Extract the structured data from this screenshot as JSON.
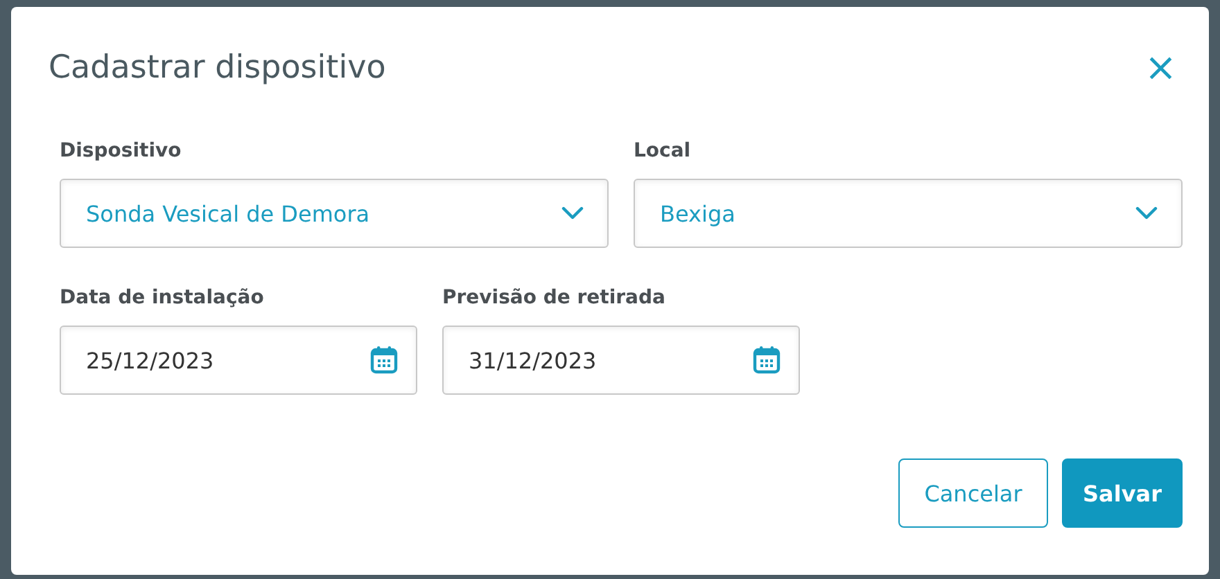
{
  "dialog": {
    "title": "Cadastrar dispositivo",
    "close": "×"
  },
  "selects": [
    {
      "label": "Dispositivo",
      "value": "Sonda Vesical de Demora"
    },
    {
      "label": "Local",
      "value": "Bexiga"
    }
  ],
  "dates": [
    {
      "label": "Data de instalação",
      "value": "25/12/2023"
    },
    {
      "label": "Previsão de retirada",
      "value": "31/12/2023"
    }
  ],
  "buttons": [
    {
      "label": "Cancelar",
      "kind": "secondary"
    },
    {
      "label": "Salvar",
      "kind": "primary"
    }
  ]
}
